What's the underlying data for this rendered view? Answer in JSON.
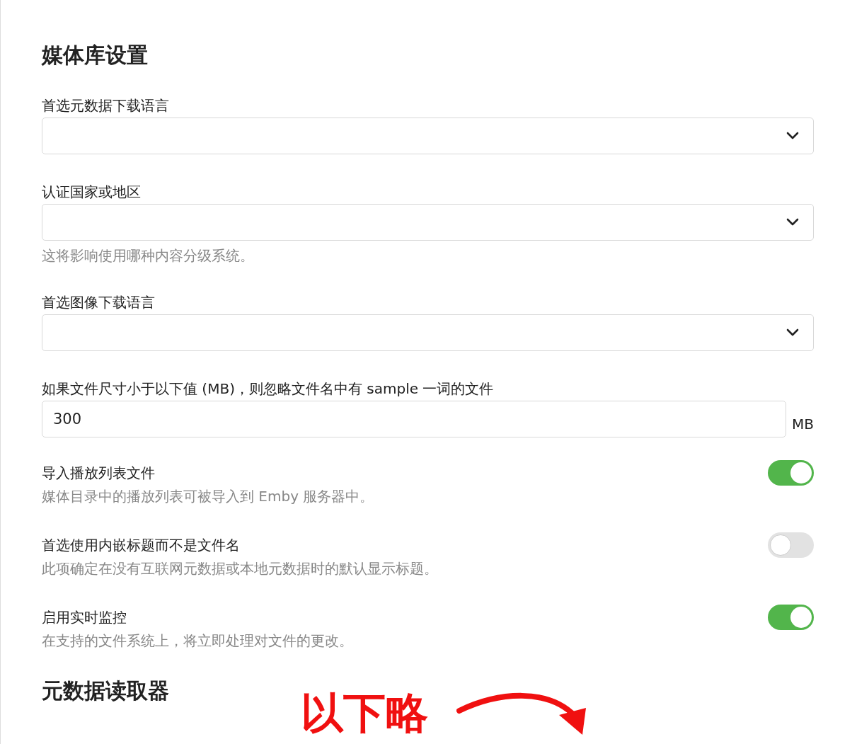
{
  "heading": "媒体库设置",
  "fields": [
    {
      "kind": "select",
      "label": "首选元数据下载语言"
    },
    {
      "kind": "select",
      "label": "认证国家或地区",
      "help": "这将影响使用哪种内容分级系统。"
    },
    {
      "kind": "select",
      "label": "首选图像下载语言"
    },
    {
      "kind": "number",
      "label": "如果文件尺寸小于以下值 (MB)，则忽略文件名中有 sample 一词的文件",
      "value": "300",
      "unit": "MB"
    },
    {
      "kind": "toggle",
      "label": "导入播放列表文件",
      "help": "媒体目录中的播放列表可被导入到 Emby 服务器中。",
      "on": true
    },
    {
      "kind": "toggle",
      "label": "首选使用内嵌标题而不是文件名",
      "help": "此项确定在没有互联网元数据或本地元数据时的默认显示标题。",
      "on": false
    },
    {
      "kind": "toggle",
      "label": "启用实时监控",
      "help": "在支持的文件系统上，将立即处理对文件的更改。",
      "on": true
    }
  ],
  "next_heading": "元数据读取器",
  "annotation": {
    "text": "以下略"
  }
}
